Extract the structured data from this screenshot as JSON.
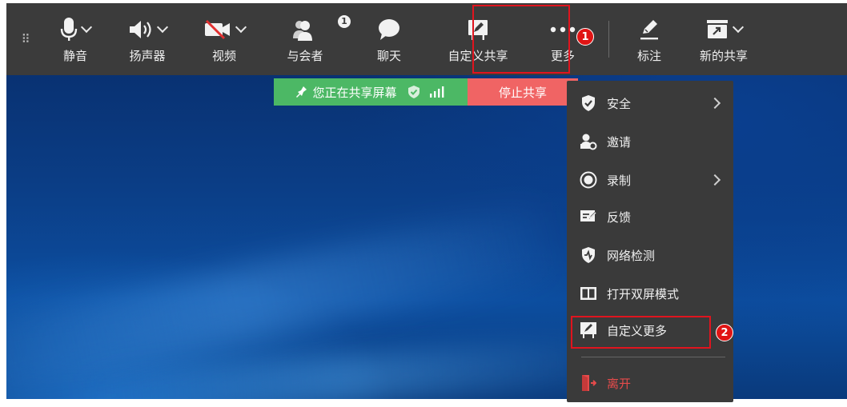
{
  "toolbar": {
    "mute_label": "静音",
    "speaker_label": "扬声器",
    "video_label": "视频",
    "participants_label": "与会者",
    "participants_count": "1",
    "chat_label": "聊天",
    "custom_share_label": "自定义共享",
    "more_label": "更多",
    "annotate_label": "标注",
    "new_share_label": "新的共享"
  },
  "sharing_banner": {
    "status_text": "您正在共享屏幕",
    "stop_label": "停止共享"
  },
  "more_menu": {
    "items": [
      {
        "label": "安全",
        "icon": "shield-check-icon",
        "has_submenu": true
      },
      {
        "label": "邀请",
        "icon": "invite-person-icon",
        "has_submenu": false
      },
      {
        "label": "录制",
        "icon": "record-icon",
        "has_submenu": true
      },
      {
        "label": "反馈",
        "icon": "feedback-icon",
        "has_submenu": false
      },
      {
        "label": "网络检测",
        "icon": "network-shield-icon",
        "has_submenu": false
      },
      {
        "label": "打开双屏模式",
        "icon": "dual-screen-icon",
        "has_submenu": false
      },
      {
        "label": "自定义更多",
        "icon": "custom-share-icon",
        "has_submenu": false
      }
    ],
    "leave_label": "离开"
  },
  "annotations": {
    "step1": "1",
    "step2": "2"
  },
  "colors": {
    "toolbar_bg": "#3b3b3b",
    "banner_green": "#4cb865",
    "stop_red": "#f06464",
    "highlight_red": "#e0141e",
    "leave_red": "#e64b4b"
  }
}
